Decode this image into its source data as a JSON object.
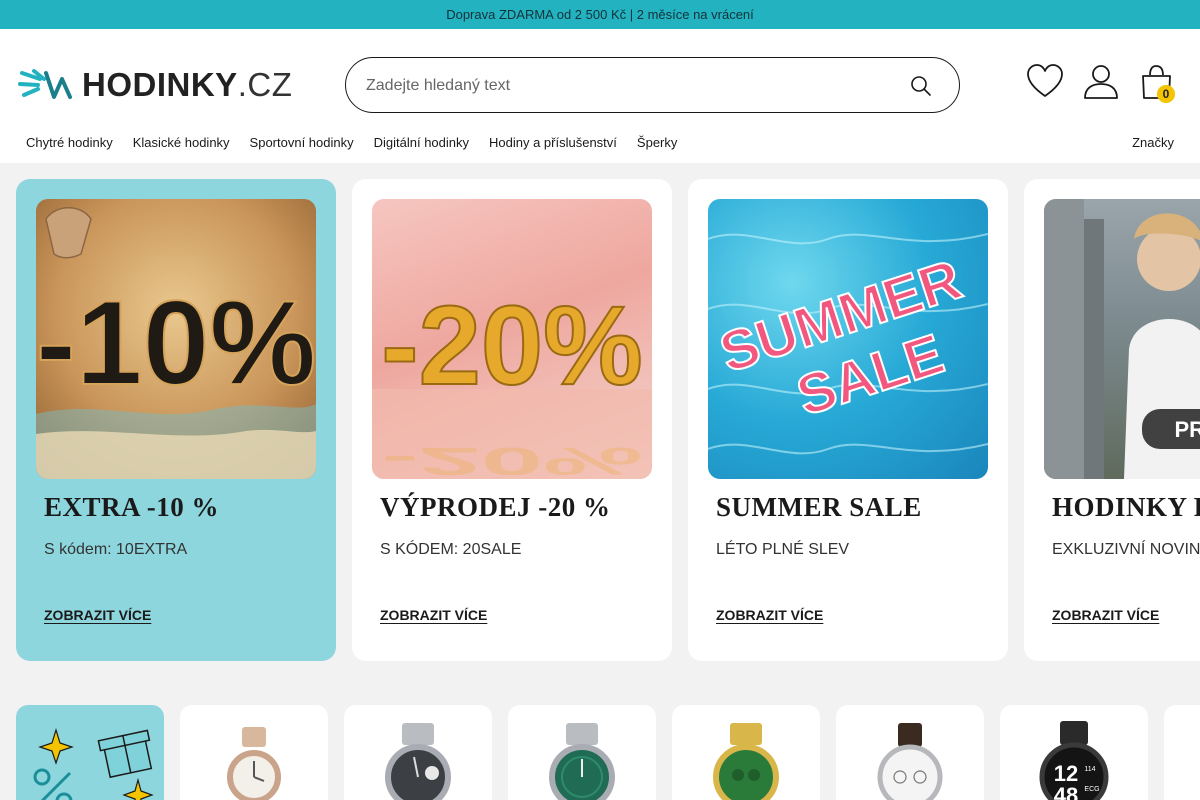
{
  "topbar": {
    "text": "Doprava ZDARMA od 2 500 Kč | 2 měsíce na vrácení"
  },
  "header": {
    "logo": {
      "main": "HODINKY",
      "tld": ".CZ"
    },
    "search": {
      "placeholder": "Zadejte hledaný text"
    },
    "cart_count": "0",
    "icons": [
      "heart-icon",
      "user-icon",
      "cart-icon",
      "search-icon"
    ]
  },
  "nav": {
    "items": [
      "Chytré hodinky",
      "Klasické hodinky",
      "Sportovní hodinky",
      "Digitální hodinky",
      "Hodiny a příslušenství",
      "Šperky"
    ],
    "brands": "Značky"
  },
  "promos": [
    {
      "title": "EXTRA -10 %",
      "subtitle": "S kódem: 10EXTRA",
      "cta": "ZOBRAZIT VÍCE",
      "badge": "-10%"
    },
    {
      "title": "VÝPRODEJ -20 %",
      "subtitle": "S KÓDEM: 20SALE",
      "cta": "ZOBRAZIT VÍCE",
      "badge": "-20%"
    },
    {
      "title": "SUMMER SALE",
      "subtitle": "LÉTO PLNÉ SLEV",
      "cta": "ZOBRAZIT VÍCE",
      "badge_line1": "SUMMER",
      "badge_line2": "SALE"
    },
    {
      "title": "HODINKY P",
      "subtitle": "EXKLUZIVNÍ NOVINK",
      "cta": "ZOBRAZIT VÍCE",
      "badge": "PRIM"
    }
  ],
  "products": {
    "smartwatch_time_h": "12",
    "smartwatch_time_m": "48",
    "smartwatch_small": "114",
    "smartwatch_ecg": "ECG"
  },
  "colors": {
    "accent": "#22b2c0",
    "card_active": "#8ed6dd",
    "badge": "#f5c400"
  }
}
